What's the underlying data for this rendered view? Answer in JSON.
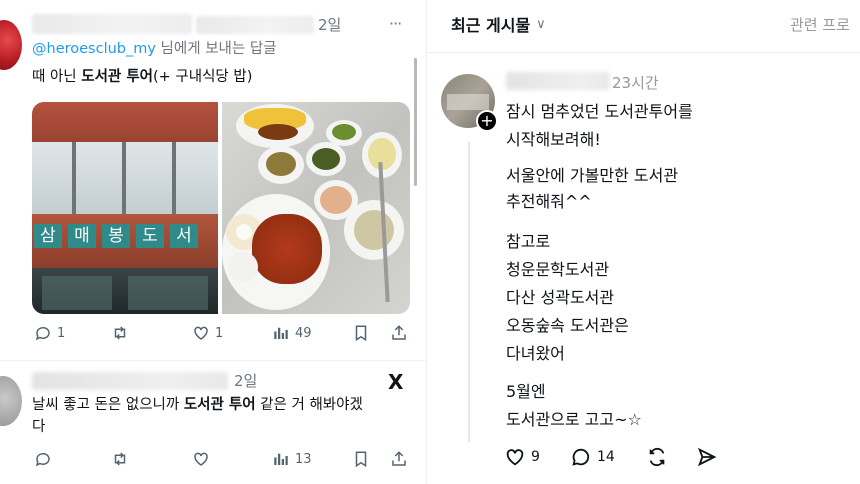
{
  "left": {
    "tweet1": {
      "time": "2일",
      "more": "···",
      "reply_to_handle": "@heroesclub_my",
      "reply_to_suffix": " 님에게 보내는 답글",
      "text_pre": "때 아닌 ",
      "text_bold": "도서관 투어",
      "text_post": "(+ 구내식당 밥)",
      "sign_chars": [
        "삼",
        "매",
        "봉",
        "도",
        "서"
      ],
      "actions": {
        "reply": "1",
        "retweet": "",
        "like": "1",
        "views": "49"
      }
    },
    "tweet2": {
      "time": "2일",
      "x_logo": "X",
      "text_line1_pre": "날씨 좋고 돈은 없으니까 ",
      "text_line1_bold": "도서관 투어",
      "text_line1_post": " 같은 거 해봐야겠",
      "text_line2": "다",
      "actions": {
        "reply": "",
        "retweet": "",
        "like": "",
        "views": "13"
      }
    }
  },
  "right": {
    "header": {
      "title": "최근 게시물",
      "chevron": "∨",
      "related": "관련 프로"
    },
    "post": {
      "time": "23시간",
      "lines": [
        "잠시 멈추었던 도서관투어를",
        "시작해보려해!",
        "서울안에 가볼만한 도서관",
        "추전해줘^^",
        "참고로",
        "청운문학도서관",
        "다산 성곽도서관",
        "오동숲속 도서관은",
        "다녀왔어",
        "5월엔",
        "도서관으로 고고~☆"
      ],
      "actions": {
        "like": "9",
        "comment": "14"
      }
    }
  },
  "colors": {
    "link": "#1d9bf0",
    "text": "#0f1419",
    "muted": "#536471"
  }
}
